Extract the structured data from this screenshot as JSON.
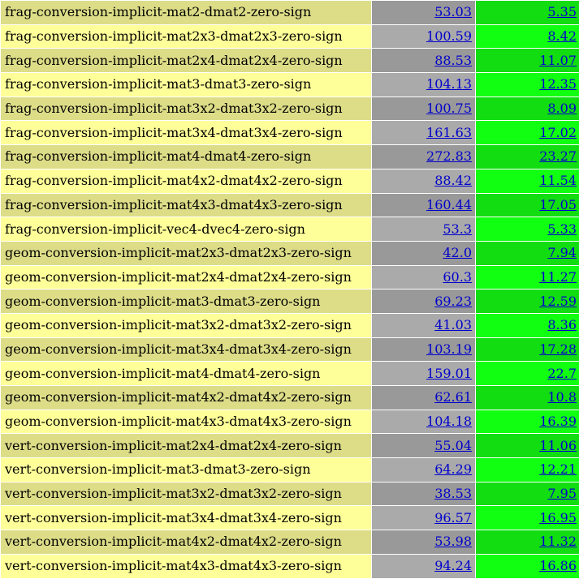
{
  "colors": {
    "name_odd": "#dddd88",
    "name_even": "#ffff99",
    "time_odd": "#999999",
    "time_even": "#aaaaaa",
    "speed_odd": "#11dd11",
    "speed_even": "#11ff11",
    "link": "#0000cc"
  },
  "rows": [
    {
      "name": "frag-conversion-implicit-mat2-dmat2-zero-sign",
      "v1": "53.03",
      "v2": "5.35"
    },
    {
      "name": "frag-conversion-implicit-mat2x3-dmat2x3-zero-sign",
      "v1": "100.59",
      "v2": "8.42"
    },
    {
      "name": "frag-conversion-implicit-mat2x4-dmat2x4-zero-sign",
      "v1": "88.53",
      "v2": "11.07"
    },
    {
      "name": "frag-conversion-implicit-mat3-dmat3-zero-sign",
      "v1": "104.13",
      "v2": "12.35"
    },
    {
      "name": "frag-conversion-implicit-mat3x2-dmat3x2-zero-sign",
      "v1": "100.75",
      "v2": "8.09"
    },
    {
      "name": "frag-conversion-implicit-mat3x4-dmat3x4-zero-sign",
      "v1": "161.63",
      "v2": "17.02"
    },
    {
      "name": "frag-conversion-implicit-mat4-dmat4-zero-sign",
      "v1": "272.83",
      "v2": "23.27"
    },
    {
      "name": "frag-conversion-implicit-mat4x2-dmat4x2-zero-sign",
      "v1": "88.42",
      "v2": "11.54"
    },
    {
      "name": "frag-conversion-implicit-mat4x3-dmat4x3-zero-sign",
      "v1": "160.44",
      "v2": "17.05"
    },
    {
      "name": "frag-conversion-implicit-vec4-dvec4-zero-sign",
      "v1": "53.3",
      "v2": "5.33"
    },
    {
      "name": "geom-conversion-implicit-mat2x3-dmat2x3-zero-sign",
      "v1": "42.0",
      "v2": "7.94"
    },
    {
      "name": "geom-conversion-implicit-mat2x4-dmat2x4-zero-sign",
      "v1": "60.3",
      "v2": "11.27"
    },
    {
      "name": "geom-conversion-implicit-mat3-dmat3-zero-sign",
      "v1": "69.23",
      "v2": "12.59"
    },
    {
      "name": "geom-conversion-implicit-mat3x2-dmat3x2-zero-sign",
      "v1": "41.03",
      "v2": "8.36"
    },
    {
      "name": "geom-conversion-implicit-mat3x4-dmat3x4-zero-sign",
      "v1": "103.19",
      "v2": "17.28"
    },
    {
      "name": "geom-conversion-implicit-mat4-dmat4-zero-sign",
      "v1": "159.01",
      "v2": "22.7"
    },
    {
      "name": "geom-conversion-implicit-mat4x2-dmat4x2-zero-sign",
      "v1": "62.61",
      "v2": "10.8"
    },
    {
      "name": "geom-conversion-implicit-mat4x3-dmat4x3-zero-sign",
      "v1": "104.18",
      "v2": "16.39"
    },
    {
      "name": "vert-conversion-implicit-mat2x4-dmat2x4-zero-sign",
      "v1": "55.04",
      "v2": "11.06"
    },
    {
      "name": "vert-conversion-implicit-mat3-dmat3-zero-sign",
      "v1": "64.29",
      "v2": "12.21"
    },
    {
      "name": "vert-conversion-implicit-mat3x2-dmat3x2-zero-sign",
      "v1": "38.53",
      "v2": "7.95"
    },
    {
      "name": "vert-conversion-implicit-mat3x4-dmat3x4-zero-sign",
      "v1": "96.57",
      "v2": "16.95"
    },
    {
      "name": "vert-conversion-implicit-mat4x2-dmat4x2-zero-sign",
      "v1": "53.98",
      "v2": "11.32"
    },
    {
      "name": "vert-conversion-implicit-mat4x3-dmat4x3-zero-sign",
      "v1": "94.24",
      "v2": "16.86"
    }
  ]
}
